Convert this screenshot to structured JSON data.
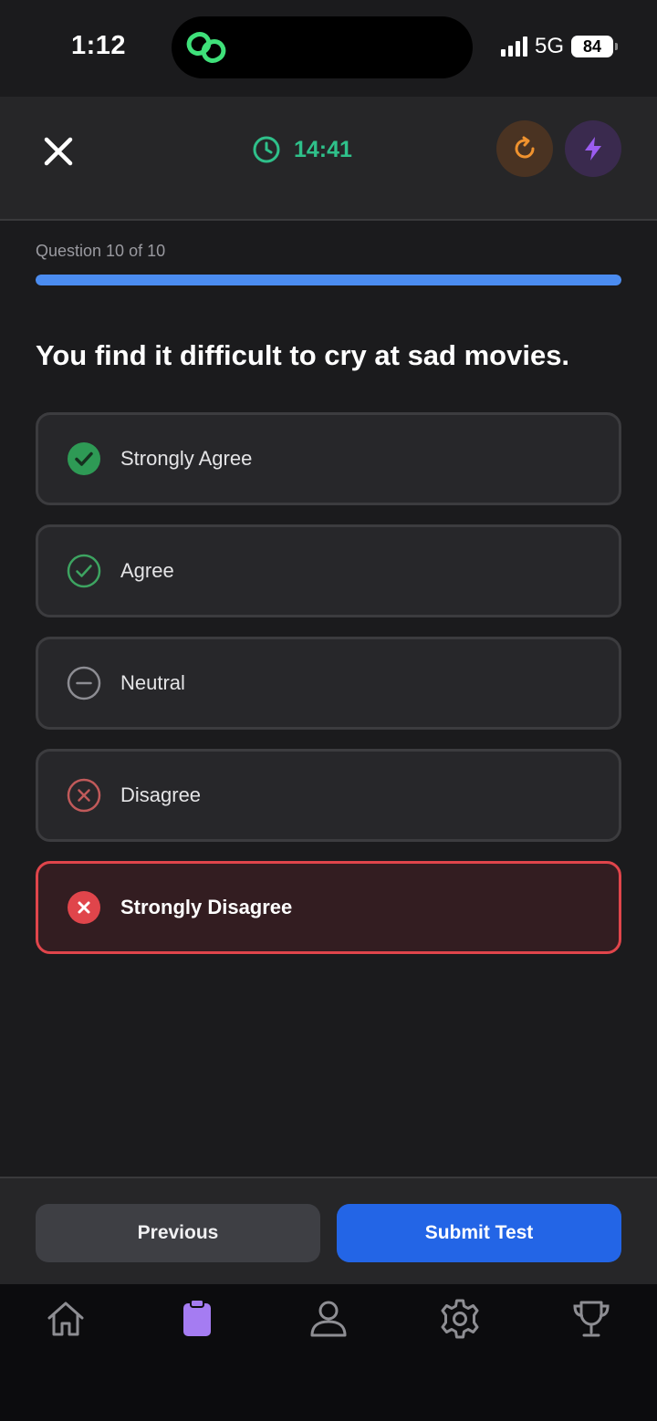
{
  "status_bar": {
    "time": "1:12",
    "network": "5G",
    "battery": "84"
  },
  "header": {
    "close_icon": "close-icon",
    "timer": "14:41",
    "timer_icon": "clock-icon",
    "refresh_icon": "refresh-icon",
    "bolt_icon": "lightning-icon",
    "colors": {
      "timer": "#2fc08a",
      "refresh": "#f0922e",
      "bolt": "#9b5cf0"
    }
  },
  "progress": {
    "label": "Question 10 of 10",
    "value": 1.0,
    "color": "#4b8cf0"
  },
  "question": "You find it difficult to cry at sad movies.",
  "options": [
    {
      "label": "Strongly Agree",
      "icon": "filled-check-circle-icon",
      "selected": false,
      "color": "#2e9a55"
    },
    {
      "label": "Agree",
      "icon": "outline-check-circle-icon",
      "selected": false,
      "color": "#3da461"
    },
    {
      "label": "Neutral",
      "icon": "minus-circle-icon",
      "selected": false,
      "color": "#8d8d93"
    },
    {
      "label": "Disagree",
      "icon": "outline-x-circle-icon",
      "selected": false,
      "color": "#c05a5a"
    },
    {
      "label": "Strongly Disagree",
      "icon": "filled-x-circle-icon",
      "selected": true,
      "color": "#e0454b"
    }
  ],
  "footer": {
    "previous_label": "Previous",
    "submit_label": "Submit Test",
    "submit_color": "#2365e6"
  },
  "tabbar": {
    "items": [
      {
        "icon": "home-icon",
        "active": false
      },
      {
        "icon": "clipboard-icon",
        "active": true
      },
      {
        "icon": "profile-icon",
        "active": false
      },
      {
        "icon": "settings-icon",
        "active": false
      },
      {
        "icon": "trophy-icon",
        "active": false
      }
    ],
    "active_color": "#a57cf2"
  }
}
